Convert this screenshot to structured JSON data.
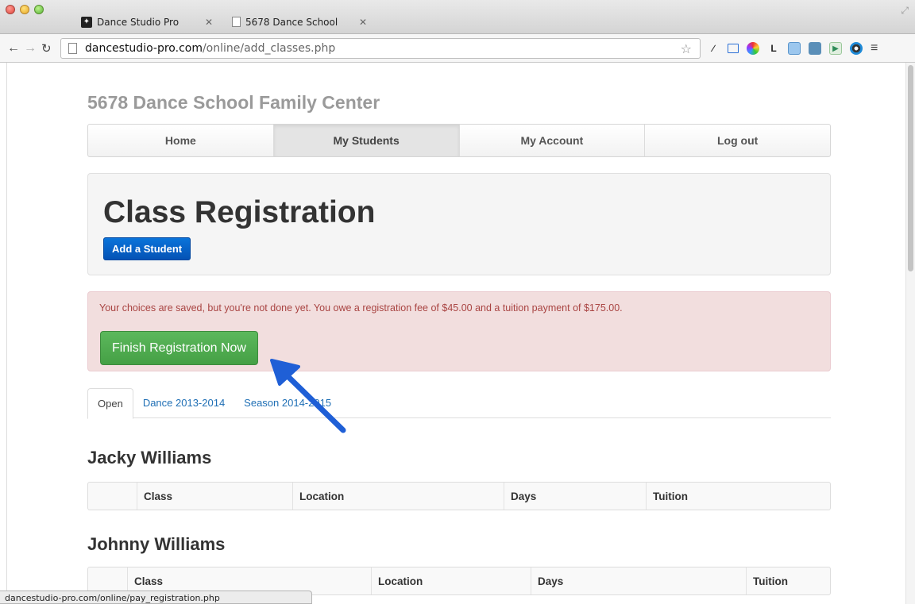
{
  "browser": {
    "tabs": [
      {
        "title": "Dance Studio Pro",
        "active": false
      },
      {
        "title": "5678 Dance School",
        "active": true
      }
    ],
    "url_host": "dancestudio-pro.com",
    "url_path": "/online/add_classes.php",
    "status_url": "dancestudio-pro.com/online/pay_registration.php"
  },
  "site": {
    "title": "5678 Dance School Family Center",
    "nav": [
      "Home",
      "My Students",
      "My Account",
      "Log out"
    ],
    "active_nav": "My Students"
  },
  "main": {
    "heading": "Class Registration",
    "add_student_label": "Add a Student",
    "alert_text": "Your choices are saved, but you're not done yet. You owe a registration fee of $45.00 and a tuition payment of $175.00.",
    "finish_label": "Finish Registration Now",
    "tabs": [
      "Open",
      "Dance 2013-2014",
      "Season 2014-2015"
    ],
    "students": [
      {
        "name": "Jacky Williams",
        "columns": [
          "",
          "Class",
          "Location",
          "Days",
          "Tuition"
        ]
      },
      {
        "name": "Johnny Williams",
        "columns": [
          "",
          "Class",
          "Location",
          "Days",
          "Tuition"
        ]
      }
    ]
  },
  "colors": {
    "primary_button": "#0452b5",
    "success_button": "#5cb85c",
    "alert_bg": "#f2dede",
    "alert_text": "#a94442",
    "annotation_arrow": "#1f5fd6"
  }
}
